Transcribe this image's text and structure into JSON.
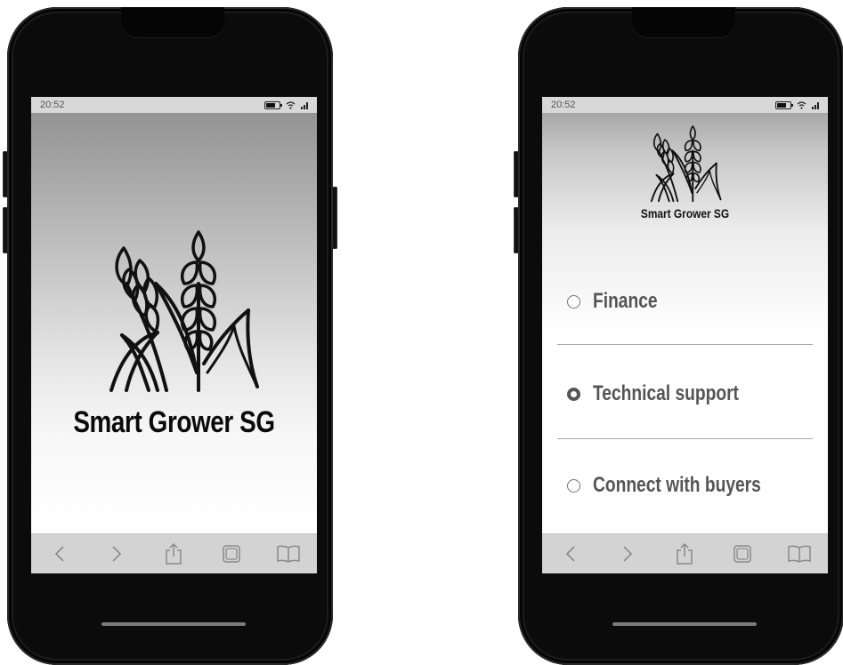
{
  "phone_left": {
    "status_bar": {
      "time": "20:52"
    },
    "app_title": "Smart Grower SG",
    "toolbar": [
      "back-icon",
      "forward-icon",
      "share-icon",
      "tabs-icon",
      "bookmarks-icon"
    ]
  },
  "phone_right": {
    "status_bar": {
      "time": "20:52"
    },
    "app_title": "Smart Grower SG",
    "menu": {
      "items": [
        {
          "label": "Finance",
          "selected": false
        },
        {
          "label": "Technical support",
          "selected": true
        },
        {
          "label": "Connect with buyers",
          "selected": false
        }
      ]
    },
    "toolbar": [
      "back-icon",
      "forward-icon",
      "share-icon",
      "tabs-icon",
      "bookmarks-icon"
    ]
  },
  "colors": {
    "phone_frame": "#0b0b0b",
    "status_bar": "#d8d8d8",
    "toolbar": "#d3d3d3",
    "menu_text": "#555555"
  }
}
